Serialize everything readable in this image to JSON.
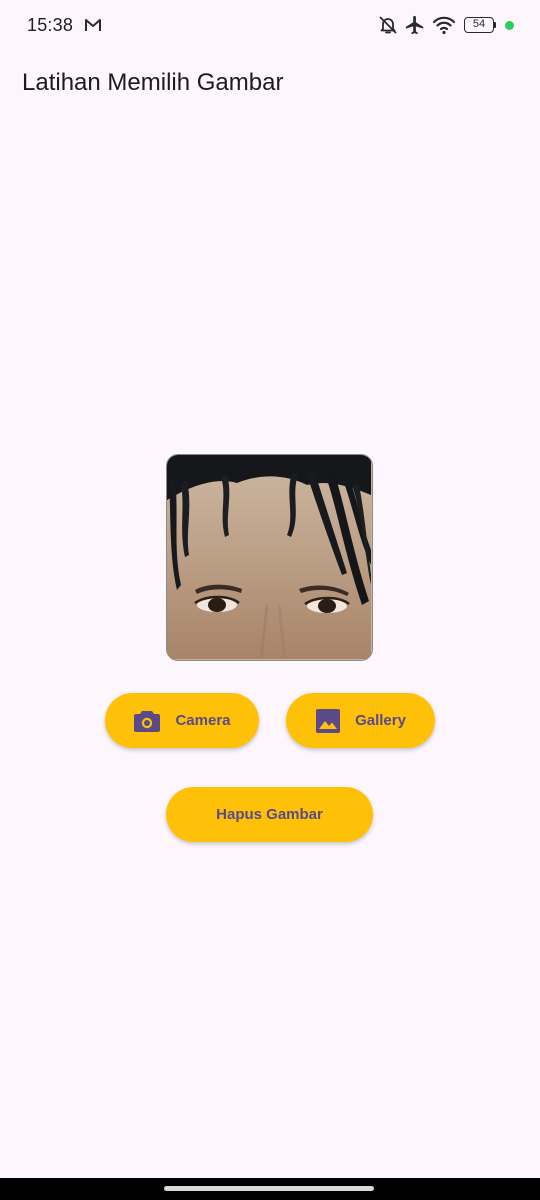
{
  "status_bar": {
    "time": "15:38",
    "notification_icon": "gmail-m-icon",
    "icons": [
      "bell-off-icon",
      "airplane-icon",
      "wifi-icon",
      "battery-icon"
    ],
    "battery_level": "54",
    "privacy_dot_color": "#2ecc5a"
  },
  "app_bar": {
    "title": "Latihan Memilih Gambar"
  },
  "image_preview": {
    "description_icon": "selected-photo"
  },
  "buttons": {
    "camera": {
      "label": "Camera",
      "icon": "camera-icon"
    },
    "gallery": {
      "label": "Gallery",
      "icon": "image-icon"
    },
    "delete": {
      "label": "Hapus Gambar"
    }
  },
  "colors": {
    "background": "#fdf7fd",
    "button": "#ffc107",
    "button_text": "#5a4a8a"
  }
}
